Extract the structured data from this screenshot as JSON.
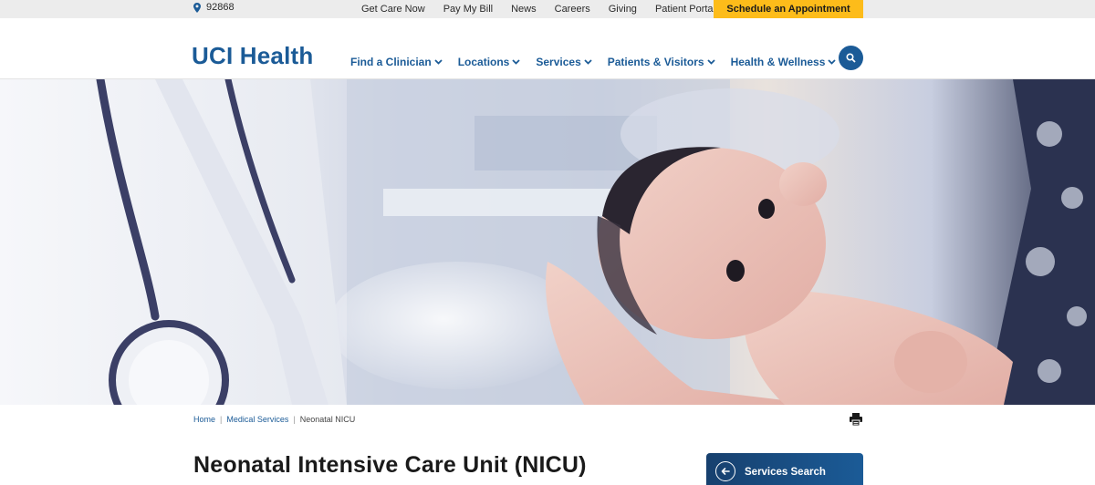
{
  "utility": {
    "zip": "92868",
    "links": [
      "Get Care Now",
      "Pay My Bill",
      "News",
      "Careers",
      "Giving",
      "Patient Portal"
    ],
    "schedule_label": "Schedule an Appointment"
  },
  "header": {
    "logo": "UCI Health",
    "nav": [
      "Find a Clinician",
      "Locations",
      "Services",
      "Patients & Visitors",
      "Health & Wellness"
    ]
  },
  "breadcrumb": {
    "home": "Home",
    "section": "Medical Services",
    "current": "Neonatal NICU"
  },
  "page": {
    "title": "Neonatal Intensive Care Unit (NICU)"
  },
  "sidebar": {
    "services_search_label": "Services Search"
  },
  "colors": {
    "brand_blue": "#1b5b97",
    "accent_yellow": "#fdbc1a",
    "utility_bg": "#ececec"
  },
  "icons": [
    "location-pin-icon",
    "chevron-down-icon",
    "search-icon",
    "print-icon",
    "arrow-left-icon"
  ]
}
